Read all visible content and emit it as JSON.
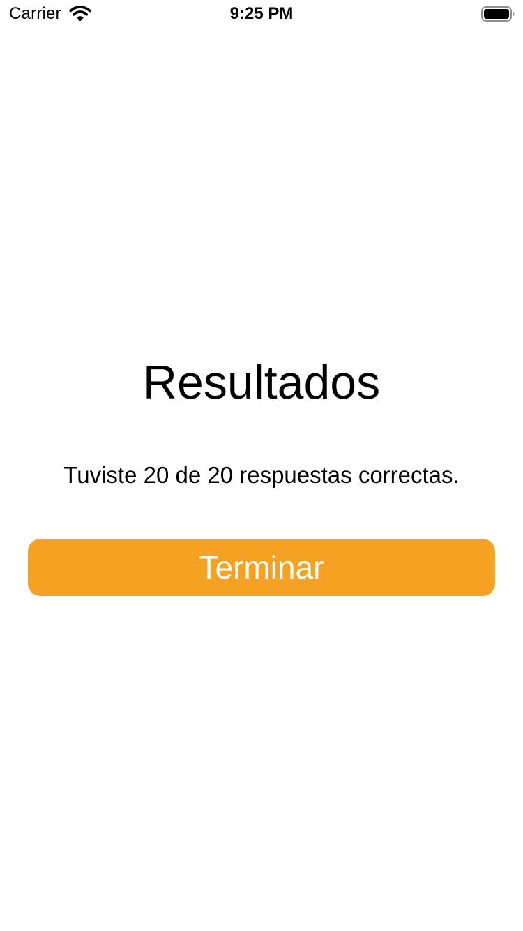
{
  "status_bar": {
    "carrier": "Carrier",
    "time": "9:25 PM",
    "wifi_icon": "wifi-icon",
    "battery_icon": "battery-icon"
  },
  "main": {
    "title": "Resultados",
    "result_text": "Tuviste 20 de 20 respuestas correctas.",
    "finish_button_label": "Terminar"
  },
  "colors": {
    "background": "#ffffff",
    "text": "#000000",
    "button_background": "#f5a222",
    "button_text": "#ffffff"
  }
}
